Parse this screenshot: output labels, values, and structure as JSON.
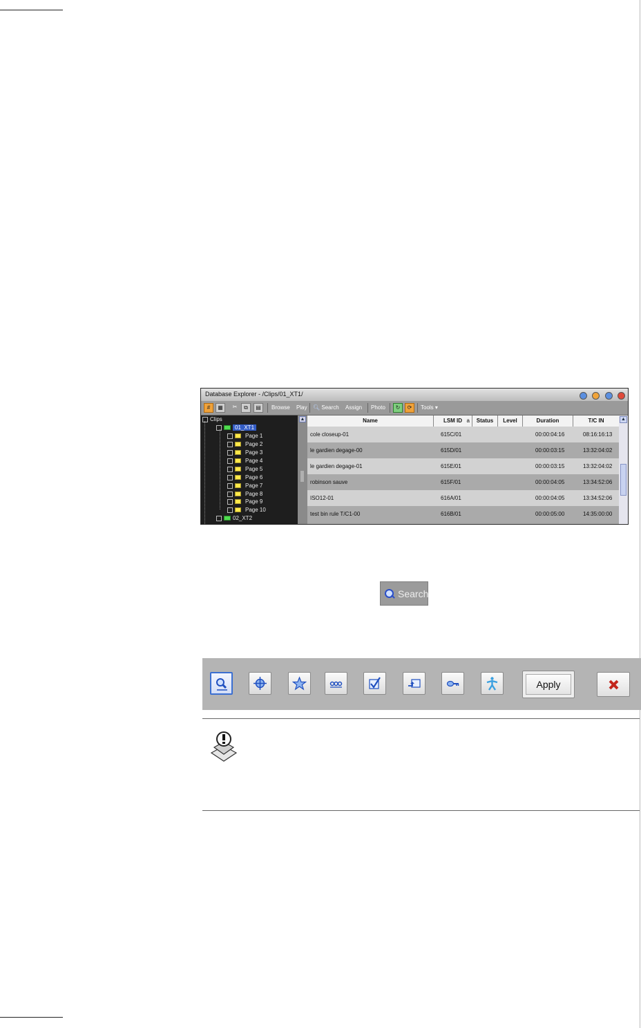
{
  "window": {
    "title": "Database Explorer - /Clips/01_XT1/"
  },
  "toolbar": {
    "browse": "Browse",
    "play": "Play",
    "search": "Search",
    "assign": "Assign",
    "photo": "Photo",
    "tools": "Tools"
  },
  "tree": {
    "root": "Clips",
    "selected": "01_XT1",
    "pages": [
      "Page 1",
      "Page 2",
      "Page 3",
      "Page 4",
      "Page 5",
      "Page 6",
      "Page 7",
      "Page 8",
      "Page 9",
      "Page 10"
    ],
    "next": "02_XT2"
  },
  "grid": {
    "columns": [
      "Name",
      "LSM ID",
      "Status",
      "Level",
      "Duration",
      "T/C IN"
    ],
    "sort_indicator": "a",
    "rows": [
      {
        "name": "cole closeup-01",
        "lsm": "615C/01",
        "status": "",
        "level": "",
        "duration": "00:00:04:16",
        "tcin": "08:16:16:13"
      },
      {
        "name": "le gardien degage-00",
        "lsm": "615D/01",
        "status": "",
        "level": "",
        "duration": "00:00:03:15",
        "tcin": "13:32:04:02"
      },
      {
        "name": "le gardien degage-01",
        "lsm": "615E/01",
        "status": "",
        "level": "",
        "duration": "00:00:03:15",
        "tcin": "13:32:04:02"
      },
      {
        "name": "robinson sauve",
        "lsm": "615F/01",
        "status": "",
        "level": "",
        "duration": "00:00:04:05",
        "tcin": "13:34:52:06"
      },
      {
        "name": "ISO12-01",
        "lsm": "616A/01",
        "status": "",
        "level": "",
        "duration": "00:00:04:05",
        "tcin": "13:34:52:06"
      },
      {
        "name": "test bin rule T/C1-00",
        "lsm": "616B/01",
        "status": "",
        "level": "",
        "duration": "00:00:05:00",
        "tcin": "14:35:00:00"
      }
    ]
  },
  "search_button": {
    "label": "Search"
  },
  "search_bar": {
    "apply_label": "Apply",
    "icons": [
      "search-icon",
      "target-icon",
      "star-icon",
      "chain-icon",
      "checkmark-icon",
      "tag-arrow-icon",
      "key-icon",
      "person-icon"
    ]
  }
}
